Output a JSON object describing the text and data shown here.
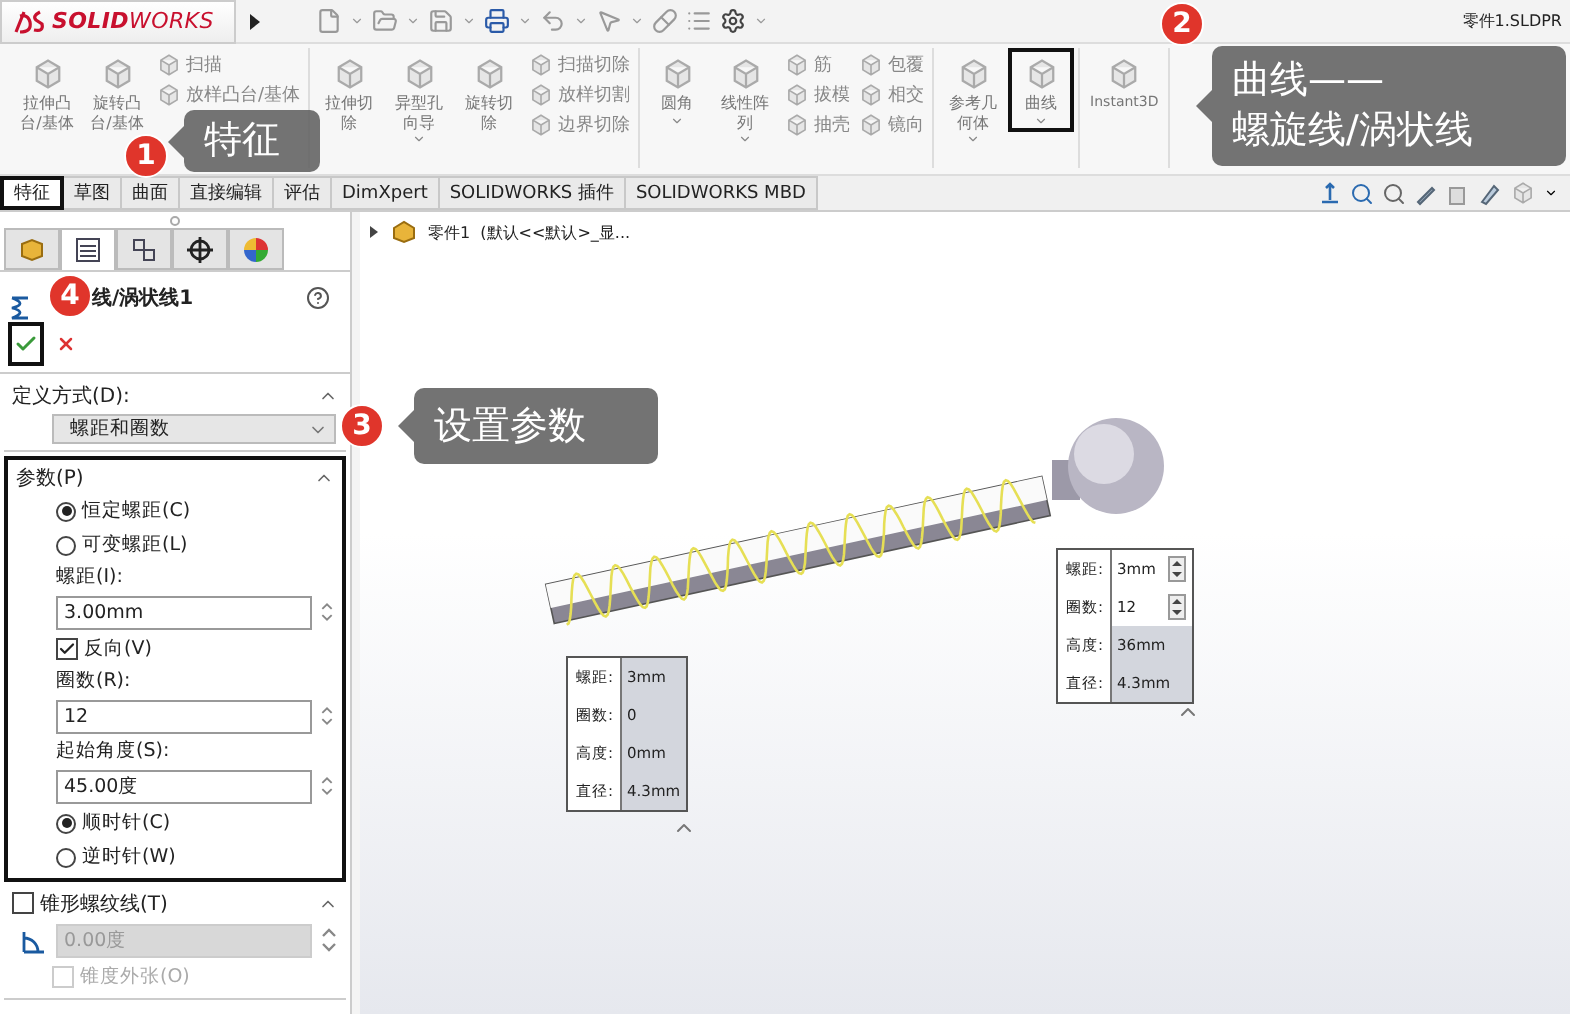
{
  "app": {
    "logo": "**SOLID**WORKS",
    "file_title": "零件1.SLDPR"
  },
  "ribbon": {
    "groups": [
      {
        "items": [
          {
            "kind": "large",
            "label": "拉伸凸台/基体",
            "highlighted": false
          },
          {
            "kind": "large",
            "label": "旋转凸台/基体",
            "highlighted": false
          },
          {
            "kind": "stack",
            "entries": [
              "扫描",
              "放样凸台/基体"
            ]
          }
        ]
      },
      {
        "items": [
          {
            "kind": "large",
            "label": "拉伸切除",
            "highlighted": false
          },
          {
            "kind": "large",
            "label": "异型孔向导",
            "dropdown": true,
            "highlighted": false
          },
          {
            "kind": "large",
            "label": "旋转切除",
            "highlighted": false
          },
          {
            "kind": "stack",
            "entries": [
              "扫描切除",
              "放样切割",
              "边界切除"
            ]
          }
        ]
      },
      {
        "items": [
          {
            "kind": "large",
            "label": "圆角",
            "dropdown": true,
            "highlighted": false
          },
          {
            "kind": "large",
            "label": "线性阵列",
            "dropdown": true,
            "highlighted": false
          },
          {
            "kind": "stack",
            "entries": [
              "筋",
              "拔模",
              "抽壳"
            ]
          },
          {
            "kind": "stack",
            "entries": [
              "包覆",
              "相交",
              "镜向"
            ]
          }
        ]
      },
      {
        "items": [
          {
            "kind": "large",
            "label": "参考几何体",
            "dropdown": true,
            "highlighted": false
          },
          {
            "kind": "large",
            "label": "曲线",
            "dropdown": true,
            "highlighted": true
          }
        ]
      },
      {
        "items": [
          {
            "kind": "wide",
            "label": "Instant3D",
            "highlighted": false
          }
        ]
      }
    ]
  },
  "tabs": [
    {
      "label": "特征",
      "selected": true
    },
    {
      "label": "草图",
      "selected": false
    },
    {
      "label": "曲面",
      "selected": false
    },
    {
      "label": "直接编辑",
      "selected": false
    },
    {
      "label": "评估",
      "selected": false
    },
    {
      "label": "DimXpert",
      "selected": false
    },
    {
      "label": "SOLIDWORKS 插件",
      "selected": false
    },
    {
      "label": "SOLIDWORKS MBD",
      "selected": false
    }
  ],
  "panel": {
    "tabs": [
      {
        "kind": "tree",
        "selected": false
      },
      {
        "kind": "property",
        "selected": true
      },
      {
        "kind": "config",
        "selected": false
      },
      {
        "kind": "dim",
        "selected": false
      },
      {
        "kind": "display",
        "selected": false
      }
    ],
    "title": "线/涡状线1",
    "ok_highlighted": true,
    "sections": [
      {
        "title": "定义方式(D):",
        "highlighted": false,
        "controls": [
          {
            "kind": "select",
            "value": "螺距和圈数"
          }
        ]
      },
      {
        "title": "参数(P)",
        "highlighted": true,
        "controls": [
          {
            "kind": "radio",
            "label": "恒定螺距(C)",
            "selected": true
          },
          {
            "kind": "radio",
            "label": "可变螺距(L)",
            "selected": false
          },
          {
            "kind": "label",
            "label": "螺距(I):"
          },
          {
            "kind": "spin",
            "value": "3.00mm",
            "disabled": false
          },
          {
            "kind": "checkbox",
            "label": "反向(V)",
            "checked": true,
            "disabled": false
          },
          {
            "kind": "label",
            "label": "圈数(R):"
          },
          {
            "kind": "spin",
            "value": "12",
            "disabled": false
          },
          {
            "kind": "label",
            "label": "起始角度(S):"
          },
          {
            "kind": "spin",
            "value": "45.00度",
            "disabled": false
          },
          {
            "kind": "radio",
            "label": "顺时针(C)",
            "selected": true
          },
          {
            "kind": "radio",
            "label": "逆时针(W)",
            "selected": false
          }
        ]
      },
      {
        "title": "锥形螺纹线(T)",
        "checkbox": true,
        "checked": false,
        "highlighted": false,
        "controls": [
          {
            "kind": "angle",
            "value": "0.00度",
            "disabled": true
          },
          {
            "kind": "checkbox",
            "label": "锥度外张(O)",
            "checked": false,
            "disabled": true
          }
        ]
      }
    ]
  },
  "viewport": {
    "tree_label": "零件1  (默认<<默认>_显...",
    "helix_callouts": [
      {
        "rows": [
          {
            "label": "螺距:",
            "value": "3mm",
            "editable": false
          },
          {
            "label": "圈数:",
            "value": "0",
            "editable": false
          },
          {
            "label": "高度:",
            "value": "0mm",
            "editable": false
          },
          {
            "label": "直径:",
            "value": "4.3mm",
            "editable": false
          }
        ]
      },
      {
        "rows": [
          {
            "label": "螺距:",
            "value": "3mm",
            "editable": true
          },
          {
            "label": "圈数:",
            "value": "12",
            "editable": true
          },
          {
            "label": "高度:",
            "value": "36mm",
            "editable": false
          },
          {
            "label": "直径:",
            "value": "4.3mm",
            "editable": false
          }
        ]
      }
    ]
  },
  "annotations": [
    {
      "number": "1",
      "lines": [
        "特征"
      ]
    },
    {
      "number": "2",
      "lines": [
        "曲线——",
        "螺旋线/涡状线"
      ]
    },
    {
      "number": "3",
      "lines": [
        "设置参数"
      ]
    },
    {
      "number": "4"
    }
  ]
}
